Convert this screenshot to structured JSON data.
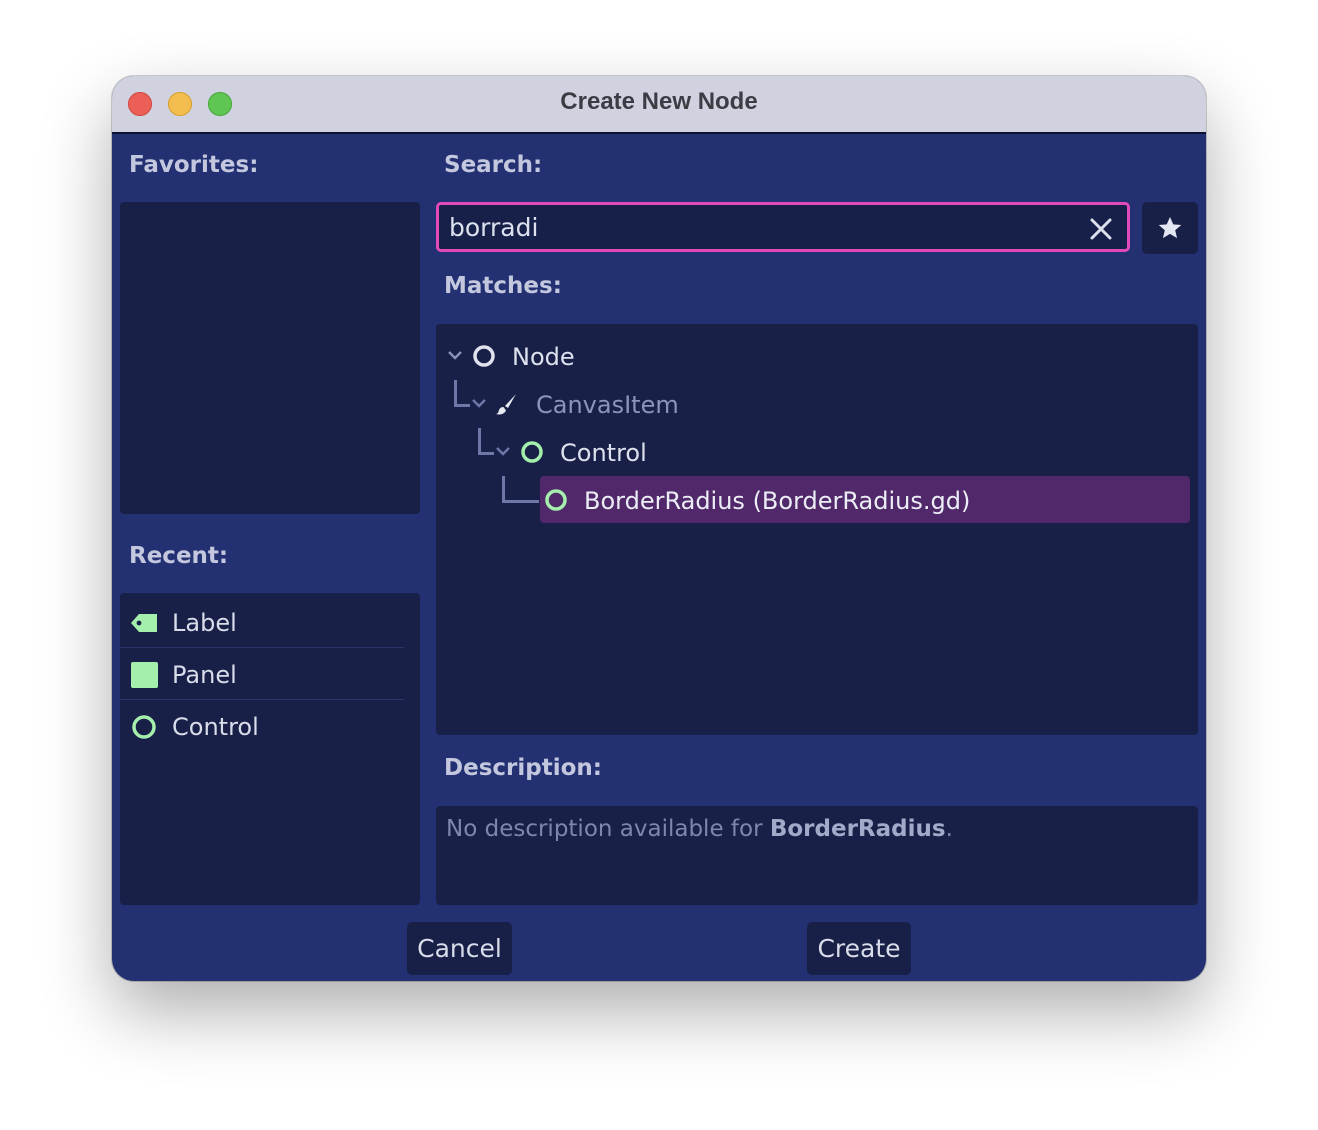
{
  "window": {
    "title": "Create New Node"
  },
  "favorites": {
    "label": "Favorites:"
  },
  "recent": {
    "label": "Recent:",
    "items": [
      {
        "label": "Label",
        "icon": "label-tag-icon"
      },
      {
        "label": "Panel",
        "icon": "panel-square-icon"
      },
      {
        "label": "Control",
        "icon": "control-circle-icon"
      }
    ]
  },
  "search": {
    "label": "Search:",
    "value": "borradi"
  },
  "matches": {
    "label": "Matches:",
    "tree": [
      {
        "label": "Node",
        "icon": "node-circle-icon",
        "expanded": true
      },
      {
        "label": "CanvasItem",
        "icon": "paintbrush-icon",
        "expanded": true,
        "disabled": true
      },
      {
        "label": "Control",
        "icon": "control-circle-icon",
        "expanded": true
      },
      {
        "label": "BorderRadius (BorderRadius.gd)",
        "icon": "control-circle-icon",
        "selected": true
      }
    ]
  },
  "description": {
    "label": "Description:",
    "prefix": "No description available for ",
    "class_name": "BorderRadius",
    "suffix": "."
  },
  "buttons": {
    "cancel": "Cancel",
    "create": "Create"
  },
  "colors": {
    "background": "#233173",
    "panel": "#182048",
    "accent_border": "#e24ab9",
    "selection": "#51286a",
    "control_green": "#a5efac"
  }
}
